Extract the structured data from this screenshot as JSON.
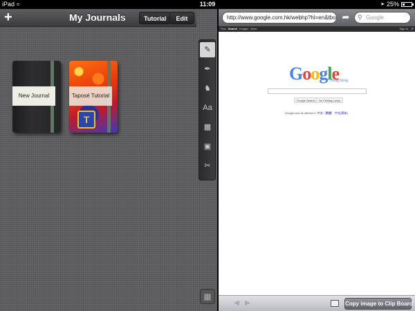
{
  "status_bar": {
    "device": "iPad",
    "wifi_icon": "wifi-icon",
    "time": "11:09",
    "battery_percent": "25%",
    "battery_level": 0.25,
    "location_icon": "location-arrow-icon"
  },
  "journals": {
    "title": "My Journals",
    "add_icon": "plus-icon",
    "tutorial_label": "Tutorial",
    "edit_label": "Edit",
    "items": [
      {
        "label": "New Journal"
      },
      {
        "label": "Taposé Tutorial"
      }
    ]
  },
  "tools": {
    "pen": "pen-icon",
    "marker": "marker-icon",
    "stamp": "stamp-icon",
    "text": "Aa",
    "eraser": "eraser-icon",
    "frame": "frame-icon",
    "scissors": "scissors-icon",
    "grid": "grid-icon"
  },
  "browser": {
    "url": "http://www.google.com.hk/webhp?hl=en&tbo...",
    "search_placeholder": "Google",
    "copy_button": "Copy image to Clip Board",
    "google": {
      "logo": "Google",
      "region": "Hong Kong",
      "topbar": [
        "Plus",
        "Search",
        "Images",
        "More"
      ],
      "sign_in": "Sign In",
      "btn_search": "Google Search",
      "btn_lucky": "I'm Feeling Lucky",
      "offered": "Google.com.hk offered in:",
      "lang1": "中文（繁體）",
      "lang2": "中文(简体)"
    }
  },
  "colors": {
    "g_blue": "#4285f4",
    "g_red": "#ea4335",
    "g_yellow": "#fbbc05",
    "g_green": "#34a853"
  }
}
